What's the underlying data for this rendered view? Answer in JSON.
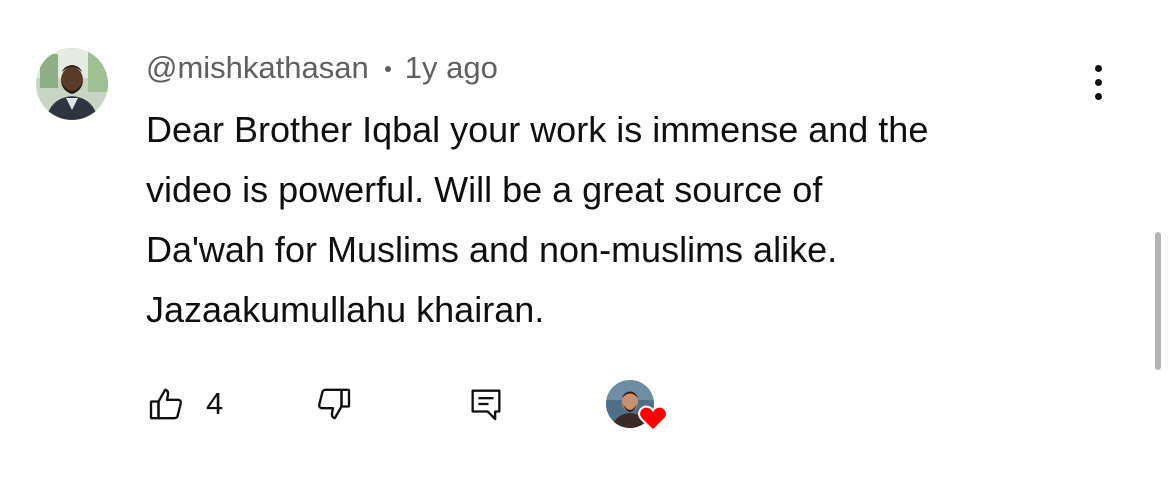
{
  "comment": {
    "author_handle": "@mishkathasan",
    "timestamp": "1y ago",
    "text_lines": [
      "Dear Brother Iqbal your work is immense and the",
      "video is powerful. Will be a great source of",
      "Da'wah for Muslims and non-muslims alike.",
      "Jazaakumullahu khairan."
    ],
    "like_count": "4"
  },
  "icons": {
    "author_avatar": "author-avatar",
    "more": "kebab-vertical-icon",
    "like": "thumbs-up-icon",
    "dislike": "thumbs-down-icon",
    "reply": "reply-comment-icon",
    "creator_heart": "heart-icon"
  },
  "colors": {
    "text_primary": "#0f0f0f",
    "text_secondary": "#606060",
    "heart": "#ff0000",
    "scrollbar": "#b5b5b5"
  }
}
